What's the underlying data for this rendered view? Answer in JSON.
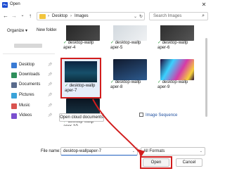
{
  "window": {
    "title": "Open",
    "app_icon": "Ps",
    "close_icon": "close-icon"
  },
  "nav": {
    "back_icon": "arrow-left-icon",
    "forward_icon": "arrow-right-icon",
    "recent_icon": "chevron-down-icon",
    "up_icon": "arrow-up-icon",
    "address": [
      "Desktop",
      "Images"
    ],
    "search_placeholder": "Search Images",
    "refresh_icon": "refresh-icon"
  },
  "toolbar": {
    "organize": "Organize ▾",
    "new_folder": "New folder"
  },
  "sidebar": {
    "items": [
      {
        "label": "Desktop",
        "icon_color": "#3a7bd5"
      },
      {
        "label": "Downloads",
        "icon_color": "#2f8f5b"
      },
      {
        "label": "Documents",
        "icon_color": "#5a6b8c"
      },
      {
        "label": "Pictures",
        "icon_color": "#3aa3d9"
      },
      {
        "label": "Music",
        "icon_color": "#d9534f"
      },
      {
        "label": "Videos",
        "icon_color": "#7a4fcf"
      }
    ]
  },
  "files": [
    {
      "name1": "desktop-wallp",
      "name2": "aper-4",
      "colors": [
        "#232323",
        "#4a4a4a"
      ]
    },
    {
      "name1": "desktop-wallp",
      "name2": "aper-5",
      "colors": [
        "#cfd6dc",
        "#f0f2f4"
      ]
    },
    {
      "name1": "desktop-wallp",
      "name2": "aper-6",
      "colors": [
        "#2a2a2a",
        "#555555"
      ]
    },
    {
      "name1": "desktop-wallp",
      "name2": "aper-7",
      "colors": [
        "#0b2340",
        "#17506b"
      ]
    },
    {
      "name1": "desktop-wallp",
      "name2": "aper-8",
      "colors": [
        "#111a2e",
        "#2d5b8f"
      ]
    },
    {
      "name1": "desktop-wallp",
      "name2": "aper-9",
      "colors": [
        "#200a38",
        "#d53aa8"
      ]
    },
    {
      "name1": "desktop-wallp",
      "name2": "aper-10",
      "colors": [
        "#0a1420",
        "#1d3d4f"
      ]
    }
  ],
  "bottom": {
    "cloud_button": "Open cloud documents",
    "image_sequence": "Image Sequence",
    "file_name_label": "File name:",
    "file_name_value": "desktop-wallpaper-7",
    "format_value": "All Formats",
    "open_button": "Open",
    "cancel_button": "Cancel"
  },
  "colors": {
    "highlight": "#d11d1d",
    "check": "#2d9c3c",
    "selection_bg": "#e6eefa"
  }
}
